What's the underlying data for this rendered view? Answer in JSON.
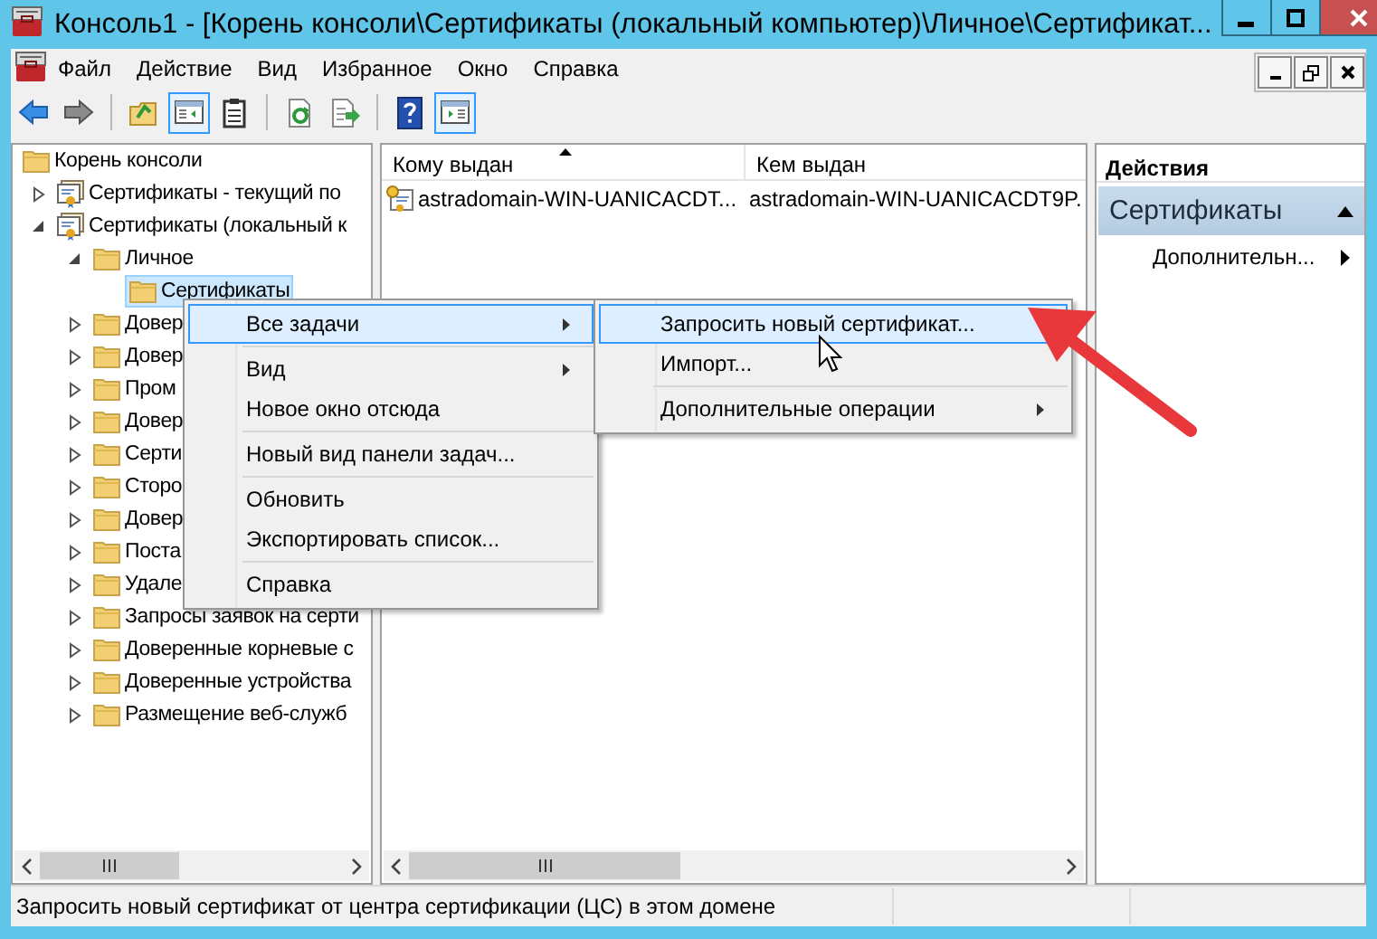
{
  "window": {
    "title": "Консоль1 - [Корень консоли\\Сертификаты (локальный компьютер)\\Личное\\Сертификат..."
  },
  "menu_bar": [
    "Файл",
    "Действие",
    "Вид",
    "Избранное",
    "Окно",
    "Справка"
  ],
  "toolbar": [
    {
      "kind": "back",
      "pressed": false
    },
    {
      "kind": "forward",
      "pressed": false
    },
    {
      "kind": "separator"
    },
    {
      "kind": "up",
      "pressed": false
    },
    {
      "kind": "tree-pane",
      "pressed": true
    },
    {
      "kind": "properties",
      "pressed": false
    },
    {
      "kind": "separator"
    },
    {
      "kind": "refresh",
      "pressed": false
    },
    {
      "kind": "export",
      "pressed": false
    },
    {
      "kind": "separator"
    },
    {
      "kind": "help",
      "pressed": false
    },
    {
      "kind": "action-pane",
      "pressed": true
    }
  ],
  "tree": [
    {
      "label": "Корень консоли",
      "kind": "folder",
      "selected": false,
      "children": [
        {
          "label": "Сертификаты - текущий по",
          "kind": "store",
          "expanded": false,
          "selected": false
        },
        {
          "label": "Сертификаты (локальный к",
          "kind": "store",
          "expanded": true,
          "selected": false,
          "children": [
            {
              "label": "Личное",
              "kind": "folder",
              "expanded": true,
              "selected": false,
              "children": [
                {
                  "label": "Сертификаты",
                  "kind": "folder",
                  "selected": true
                }
              ]
            },
            {
              "label": "Довер",
              "kind": "folder",
              "expanded": false,
              "selected": false
            },
            {
              "label": "Довер",
              "kind": "folder",
              "expanded": false,
              "selected": false
            },
            {
              "label": "Пром",
              "kind": "folder",
              "expanded": false,
              "selected": false
            },
            {
              "label": "Довер",
              "kind": "folder",
              "expanded": false,
              "selected": false
            },
            {
              "label": "Серти",
              "kind": "folder",
              "expanded": false,
              "selected": false
            },
            {
              "label": "Сторо",
              "kind": "folder",
              "expanded": false,
              "selected": false
            },
            {
              "label": "Довер",
              "kind": "folder",
              "expanded": false,
              "selected": false
            },
            {
              "label": "Поста",
              "kind": "folder",
              "expanded": false,
              "selected": false
            },
            {
              "label": "Удале",
              "kind": "folder",
              "expanded": false,
              "selected": false
            },
            {
              "label": "Запросы заявок на серти",
              "kind": "folder",
              "expanded": false,
              "selected": false
            },
            {
              "label": "Доверенные корневые с",
              "kind": "folder",
              "expanded": false,
              "selected": false
            },
            {
              "label": "Доверенные устройства",
              "kind": "folder",
              "expanded": false,
              "selected": false
            },
            {
              "label": "Размещение веб-служб",
              "kind": "folder",
              "expanded": false,
              "selected": false
            }
          ]
        }
      ]
    }
  ],
  "table": {
    "columns": [
      {
        "label": "Кому выдан",
        "sorted": true
      },
      {
        "label": "Кем выдан"
      }
    ],
    "rows": [
      [
        "astradomain-WIN-UANICACDT...",
        "astradomain-WIN-UANICACDT9P."
      ]
    ]
  },
  "actions": {
    "title": "Действия",
    "section": "Сертификаты",
    "expanded": true,
    "items": [
      {
        "label": "Дополнительн...",
        "submenu": true
      }
    ]
  },
  "context_menu": [
    {
      "kind": "item",
      "label": "Все задачи",
      "submenu": true,
      "selected": true
    },
    {
      "kind": "separator"
    },
    {
      "kind": "item",
      "label": "Вид",
      "submenu": true,
      "selected": false
    },
    {
      "kind": "item",
      "label": "Новое окно отсюда",
      "submenu": false,
      "selected": false
    },
    {
      "kind": "separator"
    },
    {
      "kind": "item",
      "label": "Новый вид панели задач...",
      "submenu": false,
      "selected": false
    },
    {
      "kind": "separator"
    },
    {
      "kind": "item",
      "label": "Обновить",
      "submenu": false,
      "selected": false
    },
    {
      "kind": "item",
      "label": "Экспортировать список...",
      "submenu": false,
      "selected": false
    },
    {
      "kind": "separator"
    },
    {
      "kind": "item",
      "label": "Справка",
      "submenu": false,
      "selected": false
    }
  ],
  "submenu": [
    {
      "kind": "item",
      "label": "Запросить новый сертификат...",
      "submenu": false,
      "selected": true
    },
    {
      "kind": "item",
      "label": "Импорт...",
      "submenu": false,
      "selected": false
    },
    {
      "kind": "separator"
    },
    {
      "kind": "item",
      "label": "Дополнительные операции",
      "submenu": true,
      "selected": false
    }
  ],
  "status_bar": "Запросить новый сертификат от центра сертификации (ЦС) в этом домене"
}
